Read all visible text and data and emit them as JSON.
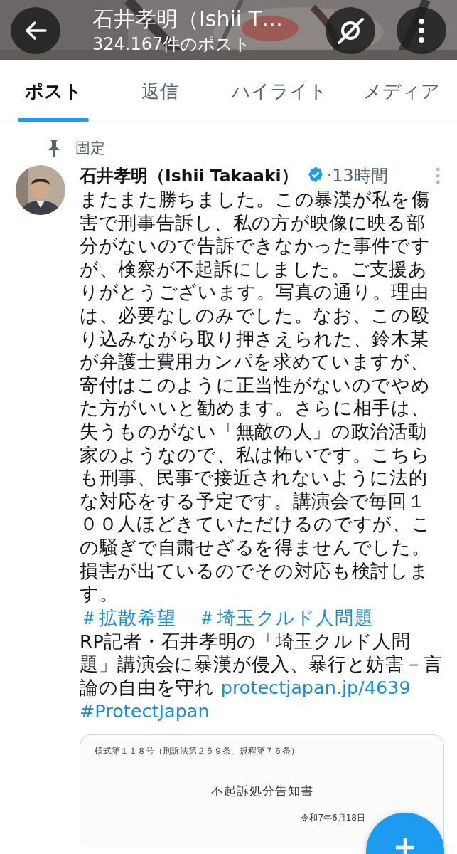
{
  "header": {
    "title": "石井孝明（Ishii T…",
    "subtitle": "324.167件のポスト"
  },
  "tabs": [
    {
      "label": "ポスト",
      "selected": true
    },
    {
      "label": "返信",
      "selected": false
    },
    {
      "label": "ハイライト",
      "selected": false
    },
    {
      "label": "メディア",
      "selected": false
    }
  ],
  "pinned_label": "固定",
  "post": {
    "author": "石井孝明（Ishii Takaaki）",
    "verified": true,
    "time": "·13時間",
    "text": "またまた勝ちました。この暴漢が私を傷害で刑事告訴し、私の方が映像に映る部分がないので告訴できなかった事件ですが、検察が不起訴にしました。ご支援ありがとうございます。写真の通り。理由は、必要なしのみでした。なお、この殴り込みながら取り押さえられた、鈴木某が弁護士費用カンパを求めていますが、寄付はこのように正当性がないのでやめた方がいいと勧めます。さらに相手は、失うものがない「無敵の人」の政治活動家のようなので、私は怖いです。こちらも刑事、民事で接近されないように法的な対応をする予定です。講演会で毎回１００人ほどきていただけるのですが、この騒ぎで自粛せざるを得ませんでした。損害が出ているのでその対応も検討します。",
    "hashtags": [
      "＃拡散希望",
      "＃埼玉クルド人問題"
    ],
    "card_text": "RP記者・石井孝明の「埼玉クルド人問題」講演会に暴漢が侵入、暴行と妨害－言論の自由を守れ",
    "link": "protectjapan.jp/4639",
    "tag": "#ProtectJapan",
    "attachment": {
      "form_line": "様式第１１８号（刑訴法第２５９条、規程第７６条）",
      "title": "不起訴処分告知書",
      "date": "令和7年6月18日"
    }
  }
}
